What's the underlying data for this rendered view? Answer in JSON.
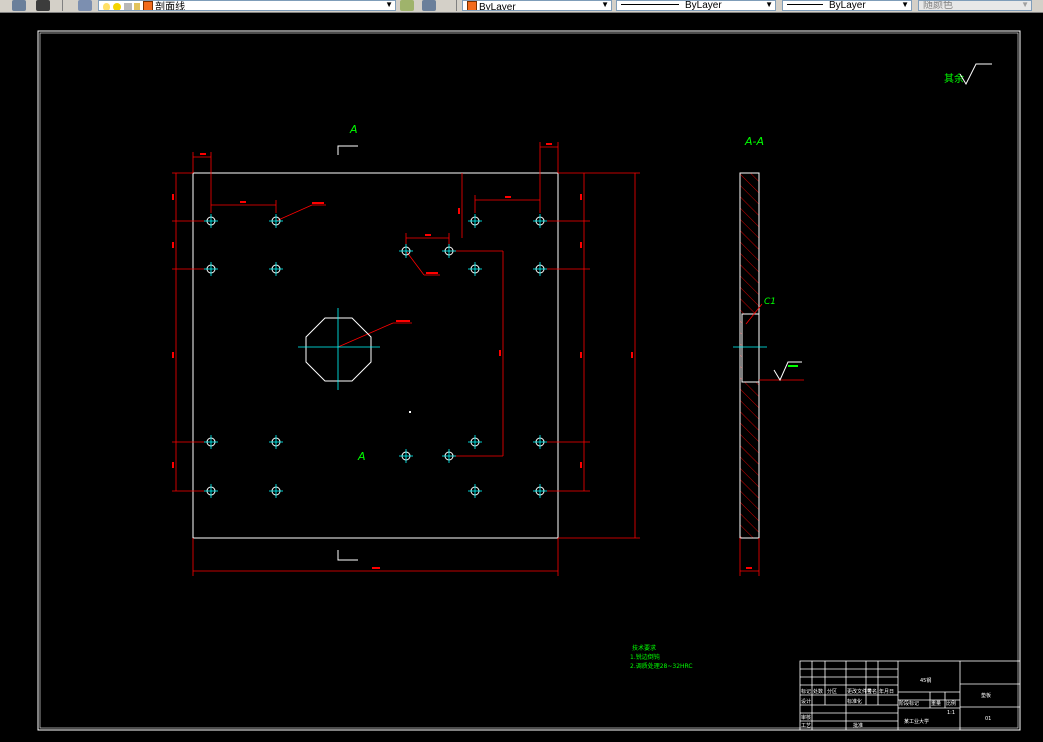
{
  "toolbar": {
    "layer_name": "剖面线",
    "color_value": "ByLayer",
    "linetype_value": "ByLayer",
    "lineweight_value": "ByLayer",
    "plotstyle_value": "随颜色",
    "colors": {
      "layer_swatch": "#f26b1d",
      "color_swatch": "#f26b1d"
    }
  },
  "drawing": {
    "section_mark_top": "A",
    "section_mark_bottom": "A",
    "section_view_label": "A-A",
    "chamfer_label": "C1",
    "roughness_note": "其余",
    "notes": [
      "技术要求",
      "1.锐边倒钝",
      "2.调质处理28~32HRC"
    ],
    "colors": {
      "outline": "#ffffff",
      "dimension": "#ff0000",
      "center": "#00ffff",
      "text": "#00ff00",
      "hatch": "#ff0000"
    }
  },
  "title_block": {
    "cells": [
      "标记",
      "处数",
      "分区",
      "更改文件号",
      "签名",
      "年月日",
      "设计",
      "标准化",
      "阶段标记",
      "重量",
      "比例",
      "审核",
      "工艺",
      "批准"
    ],
    "material": "45钢",
    "scale": "1:1",
    "company": "某工业大学",
    "drawing_name": "垫板",
    "drawing_number": "01"
  }
}
